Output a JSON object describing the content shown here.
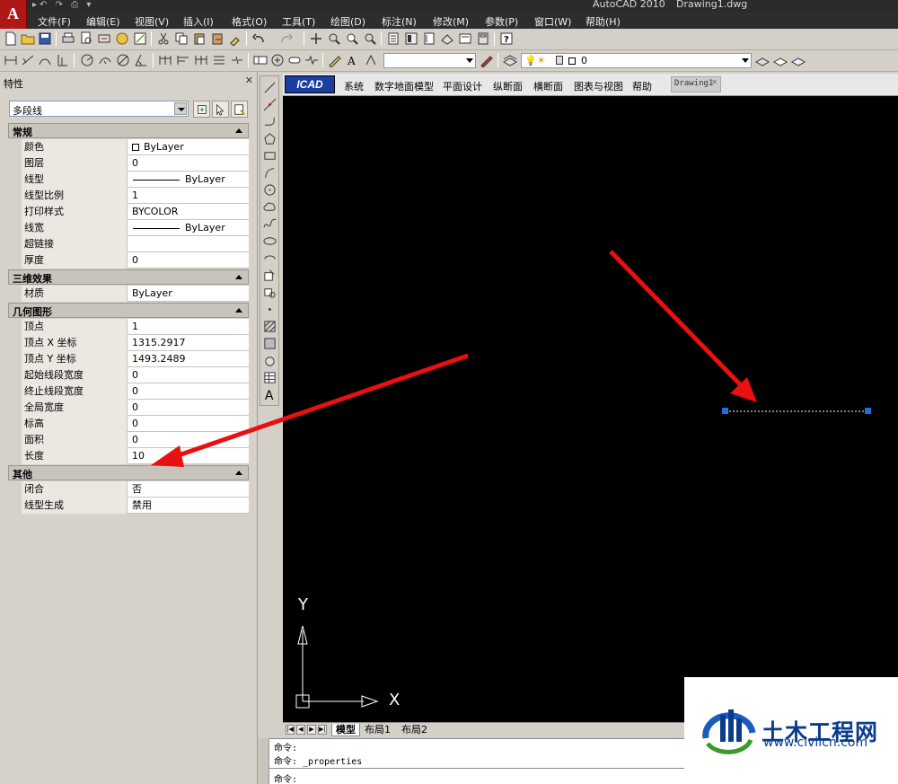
{
  "title_bar": {
    "app_letter": "A",
    "app_name": "AutoCAD 2010",
    "document": "Drawing1.dwg"
  },
  "menu": [
    {
      "label": "文件(F)"
    },
    {
      "label": "编辑(E)"
    },
    {
      "label": "视图(V)"
    },
    {
      "label": "插入(I)"
    },
    {
      "label": "格式(O)"
    },
    {
      "label": "工具(T)"
    },
    {
      "label": "绘图(D)"
    },
    {
      "label": "标注(N)"
    },
    {
      "label": "修改(M)"
    },
    {
      "label": "参数(P)"
    },
    {
      "label": "窗口(W)"
    },
    {
      "label": "帮助(H)"
    }
  ],
  "layer_toolbar": {
    "current_layer": "0"
  },
  "properties": {
    "title": "特性",
    "close_glyph": "✕",
    "object_type": "多段线",
    "sections": [
      {
        "title": "常规",
        "rows": [
          {
            "name": "颜色",
            "value": "ByLayer",
            "kind": "color"
          },
          {
            "name": "图层",
            "value": "0",
            "kind": "text"
          },
          {
            "name": "线型",
            "value": "ByLayer",
            "kind": "line"
          },
          {
            "name": "线型比例",
            "value": "1",
            "kind": "text"
          },
          {
            "name": "打印样式",
            "value": "BYCOLOR",
            "kind": "text"
          },
          {
            "name": "线宽",
            "value": "ByLayer",
            "kind": "line"
          },
          {
            "name": "超链接",
            "value": "",
            "kind": "text"
          },
          {
            "name": "厚度",
            "value": "0",
            "kind": "text"
          }
        ]
      },
      {
        "title": "三维效果",
        "rows": [
          {
            "name": "材质",
            "value": "ByLayer",
            "kind": "text"
          }
        ]
      },
      {
        "title": "几何图形",
        "rows": [
          {
            "name": "顶点",
            "value": "1",
            "kind": "text"
          },
          {
            "name": "顶点 X 坐标",
            "value": "1315.2917",
            "kind": "text"
          },
          {
            "name": "顶点 Y 坐标",
            "value": "1493.2489",
            "kind": "text"
          },
          {
            "name": "起始线段宽度",
            "value": "0",
            "kind": "text"
          },
          {
            "name": "终止线段宽度",
            "value": "0",
            "kind": "text"
          },
          {
            "name": "全局宽度",
            "value": "0",
            "kind": "text"
          },
          {
            "name": "标高",
            "value": "0",
            "kind": "text"
          },
          {
            "name": "面积",
            "value": "0",
            "kind": "text"
          },
          {
            "name": "长度",
            "value": "10",
            "kind": "text"
          }
        ]
      },
      {
        "title": "其他",
        "rows": [
          {
            "name": "闭合",
            "value": "否",
            "kind": "text"
          },
          {
            "name": "线型生成",
            "value": "禁用",
            "kind": "text"
          }
        ]
      }
    ]
  },
  "icad": {
    "logo": "ICAD",
    "menus": [
      "系统",
      "数字地面模型",
      "平面设计",
      "纵断面",
      "横断面",
      "图表与视图",
      "帮助"
    ],
    "doc_tab": "Drawing1",
    "doc_tab_close": "✕"
  },
  "canvas": {
    "background": "#000000",
    "selection_grip_color": "#1e6fd9",
    "arrow_color": "#e81010",
    "ucs_x_label": "X",
    "ucs_y_label": "Y"
  },
  "layout_tabs": {
    "nav_buttons": [
      "|◀",
      "◀",
      "▶",
      "▶|"
    ],
    "tabs": [
      "模型",
      "布局1",
      "布局2"
    ]
  },
  "command_window": {
    "lines": [
      "命令:",
      "命令:  _properties"
    ],
    "prompt": "命令:"
  },
  "watermark": {
    "text": "土木工程网",
    "url": "www.civilcn.com"
  }
}
